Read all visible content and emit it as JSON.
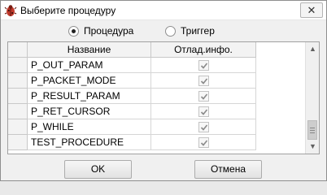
{
  "window": {
    "title": "Выберите процедуру",
    "close_glyph": "✕"
  },
  "radios": [
    {
      "label": "Процедура",
      "checked": true
    },
    {
      "label": "Триггер",
      "checked": false
    }
  ],
  "grid": {
    "columns": [
      "Название",
      "Отлад.инфо."
    ],
    "rows": [
      {
        "name": "P_OUT_PARAM",
        "debug": true
      },
      {
        "name": "P_PACKET_MODE",
        "debug": true
      },
      {
        "name": "P_RESULT_PARAM",
        "debug": true
      },
      {
        "name": "P_RET_CURSOR",
        "debug": true
      },
      {
        "name": "P_WHILE",
        "debug": true
      },
      {
        "name": "TEST_PROCEDURE",
        "debug": true
      }
    ]
  },
  "buttons": {
    "ok": "OK",
    "cancel": "Отмена"
  }
}
